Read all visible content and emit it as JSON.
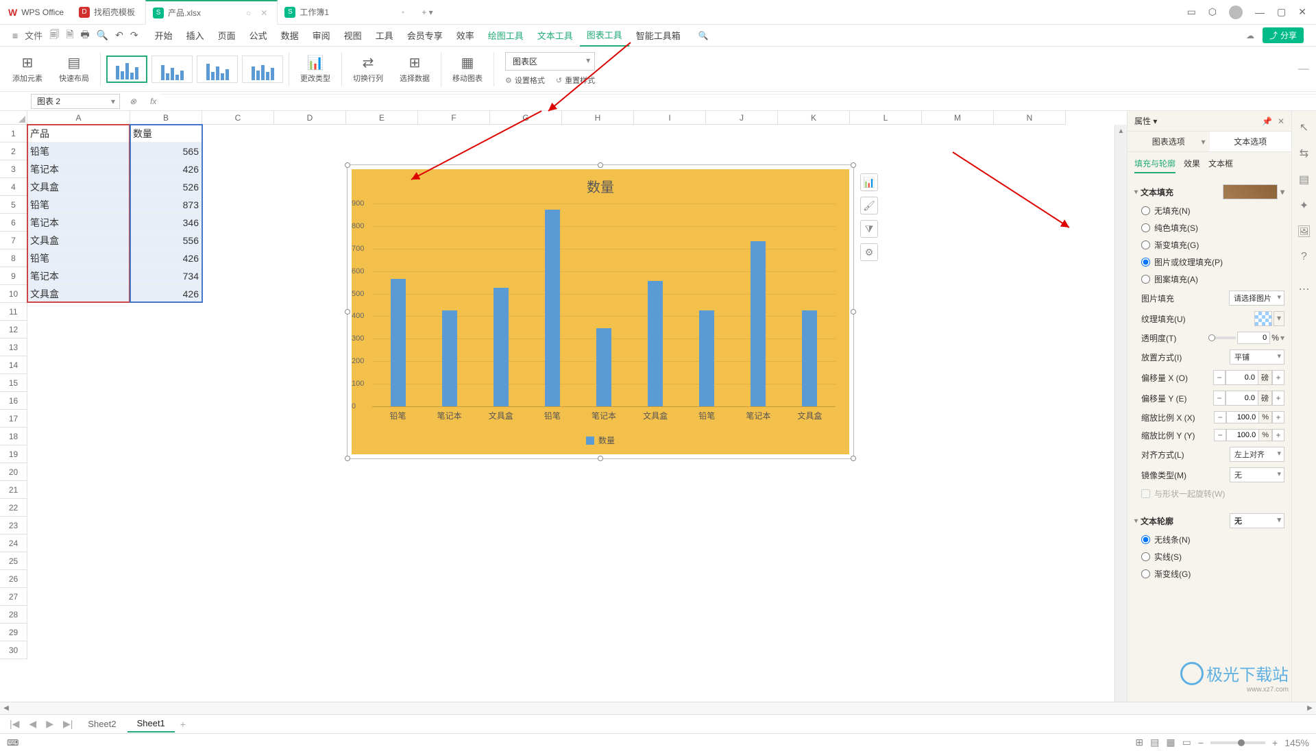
{
  "titlebar": {
    "brand": "WPS Office",
    "tabs": [
      {
        "label": "找稻壳模板",
        "icon": "red"
      },
      {
        "label": "产品.xlsx",
        "icon": "grn",
        "active": true
      },
      {
        "label": "工作簿1",
        "icon": "grn"
      }
    ]
  },
  "menubar": {
    "file": "文件",
    "items": [
      "开始",
      "插入",
      "页面",
      "公式",
      "数据",
      "审阅",
      "视图",
      "工具",
      "会员专享",
      "效率",
      "绘图工具",
      "文本工具",
      "图表工具",
      "智能工具箱"
    ],
    "active": "图表工具",
    "green": [
      "绘图工具",
      "文本工具"
    ],
    "share": "分享"
  },
  "ribbon": {
    "add_element": "添加元素",
    "quick_layout": "快速布局",
    "change_type": "更改类型",
    "switch_rc": "切换行列",
    "select_data": "选择数据",
    "move_chart": "移动图表",
    "area_dd": "图表区",
    "fmt": "设置格式",
    "reset": "重置样式"
  },
  "namebox": "图表 2",
  "cols": [
    "A",
    "B",
    "C",
    "D",
    "E",
    "F",
    "G",
    "H",
    "I",
    "J",
    "K",
    "L",
    "M",
    "N"
  ],
  "table": {
    "h1": "产品",
    "h2": "数量",
    "rows": [
      {
        "p": "铅笔",
        "q": "565"
      },
      {
        "p": "笔记本",
        "q": "426"
      },
      {
        "p": "文具盒",
        "q": "526"
      },
      {
        "p": "铅笔",
        "q": "873"
      },
      {
        "p": "笔记本",
        "q": "346"
      },
      {
        "p": "文具盒",
        "q": "556"
      },
      {
        "p": "铅笔",
        "q": "426"
      },
      {
        "p": "笔记本",
        "q": "734"
      },
      {
        "p": "文具盒",
        "q": "426"
      }
    ]
  },
  "chart_data": {
    "type": "bar",
    "title": "数量",
    "legend": "数量",
    "categories": [
      "铅笔",
      "笔记本",
      "文具盒",
      "铅笔",
      "笔记本",
      "文具盒",
      "铅笔",
      "笔记本",
      "文具盒"
    ],
    "values": [
      565,
      426,
      526,
      873,
      346,
      556,
      426,
      734,
      426
    ],
    "yticks": [
      0,
      100,
      200,
      300,
      400,
      500,
      600,
      700,
      800,
      900
    ],
    "ylim": [
      0,
      900
    ]
  },
  "panel": {
    "title": "属性",
    "tab_chart": "图表选项",
    "tab_text": "文本选项",
    "sub": [
      "填充与轮廓",
      "效果",
      "文本框"
    ],
    "sec_fill": "文本填充",
    "no_fill": "无填充(N)",
    "solid": "纯色填充(S)",
    "gradient": "渐变填充(G)",
    "pic_tex": "图片或纹理填充(P)",
    "pattern": "图案填充(A)",
    "pic_fill": "图片填充",
    "pic_sel": "请选择图片",
    "tex_fill": "纹理填充(U)",
    "opacity": "透明度(T)",
    "opacity_v": "0",
    "pct": "%",
    "place": "放置方式(I)",
    "place_v": "平铺",
    "offx": "偏移量 X (O)",
    "offy": "偏移量 Y (E)",
    "offv": "0.0",
    "unit_pt": "磅",
    "sclx": "缩放比例 X (X)",
    "scly": "缩放比例 Y (Y)",
    "sclv": "100.0",
    "align": "对齐方式(L)",
    "align_v": "左上对齐",
    "mirror": "镜像类型(M)",
    "mirror_v": "无",
    "rotate": "与形状一起旋转(W)",
    "sec_outline": "文本轮廓",
    "outline_v": "无",
    "no_line": "无线条(N)",
    "solid_line": "实线(S)",
    "grad_line": "渐变线(G)"
  },
  "sheets": {
    "s1": "Sheet2",
    "s2": "Sheet1"
  },
  "status": {
    "zoom": "145%"
  }
}
